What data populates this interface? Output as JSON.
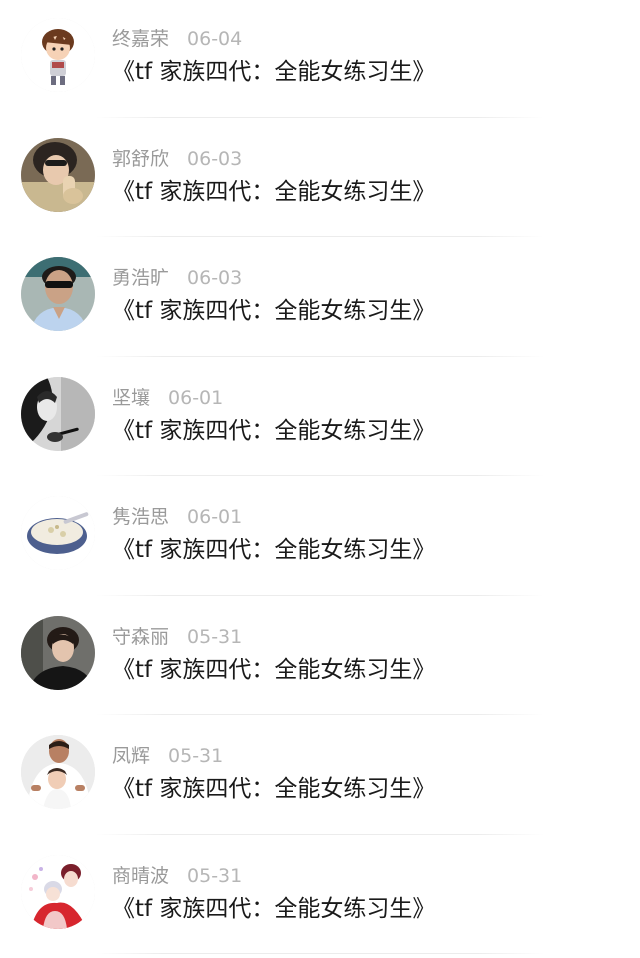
{
  "items": [
    {
      "name": "终嘉荣",
      "date": "06-04",
      "message": "《tf 家族四代：全能女练习生》",
      "avatar": "cartoon-boy-avatar"
    },
    {
      "name": "郭舒欣",
      "date": "06-03",
      "message": "《tf 家族四代：全能女练习生》",
      "avatar": "woman-selfie-avatar"
    },
    {
      "name": "勇浩旷",
      "date": "06-03",
      "message": "《tf 家族四代：全能女练习生》",
      "avatar": "man-sunglasses-avatar"
    },
    {
      "name": "坚壤",
      "date": "06-01",
      "message": "《tf 家族四代：全能女练习生》",
      "avatar": "woman-bw-avatar"
    },
    {
      "name": "隽浩思",
      "date": "06-01",
      "message": "《tf 家族四代：全能女练习生》",
      "avatar": "soup-bowl-avatar"
    },
    {
      "name": "守森丽",
      "date": "05-31",
      "message": "《tf 家族四代：全能女练习生》",
      "avatar": "young-man-avatar"
    },
    {
      "name": "凤辉",
      "date": "05-31",
      "message": "《tf 家族四代：全能女练习生》",
      "avatar": "father-child-avatar"
    },
    {
      "name": "商晴波",
      "date": "05-31",
      "message": "《tf 家族四代：全能女练习生》",
      "avatar": "anime-couple-avatar"
    }
  ]
}
